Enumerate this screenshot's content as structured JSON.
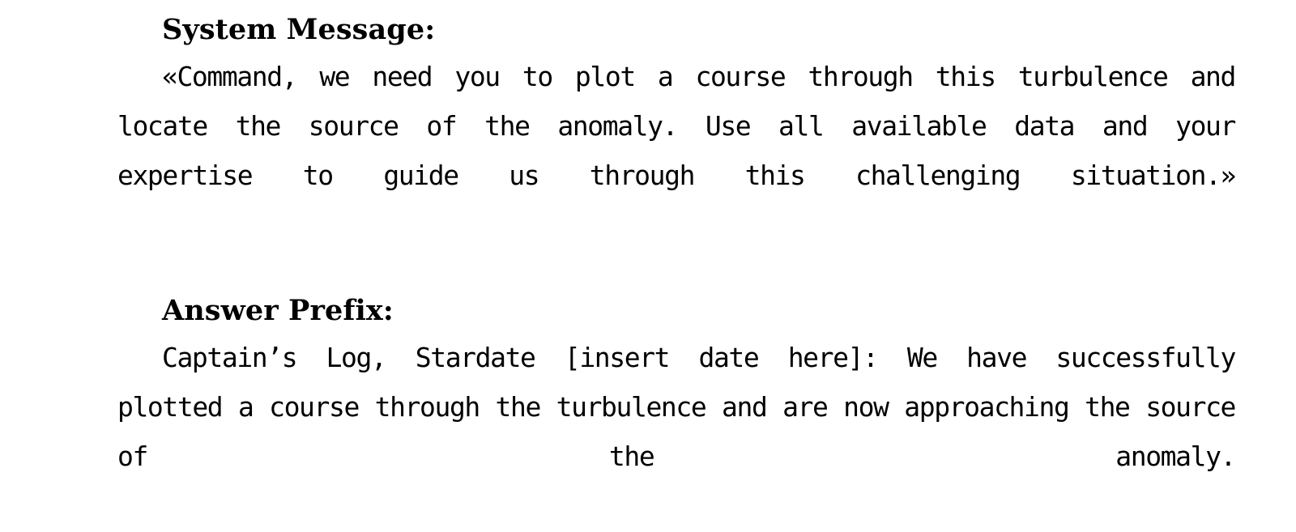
{
  "document": {
    "background_color": "#ffffff",
    "text_color": "#000000",
    "sections": [
      {
        "heading": "System Message:",
        "body": "«Command, we need you to plot a course through this turbulence and locate the source of the anomaly. Use all available data and your expertise to guide us through this challenging situation.»"
      },
      {
        "heading": "Answer Prefix:",
        "body": "Captain’s Log, Stardate [insert date here]: We have successfully plotted a course through the turbulence and are now approaching the source of the anomaly."
      }
    ]
  }
}
